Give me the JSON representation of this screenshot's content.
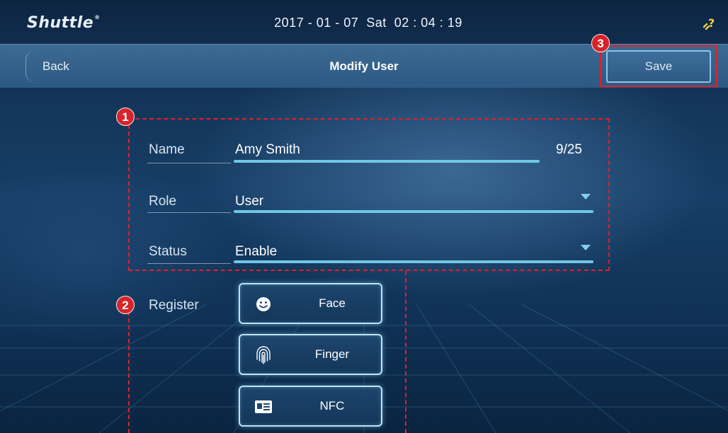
{
  "topbar": {
    "logo": "Shuttle",
    "logo_mark": "®",
    "datetime": "2017 - 01 - 07  Sat  02 : 04 : 19",
    "link_icon": "?"
  },
  "header": {
    "back_label": "Back",
    "title": "Modify User",
    "save_label": "Save"
  },
  "callouts": {
    "fields_group": "1",
    "register_group": "2",
    "save": "3"
  },
  "form": {
    "name": {
      "label": "Name",
      "value": "Amy Smith",
      "counter": "9/25"
    },
    "role": {
      "label": "Role",
      "value": "User"
    },
    "status": {
      "label": "Status",
      "value": "Enable"
    },
    "register": {
      "label": "Register",
      "buttons": [
        {
          "label": "Face",
          "icon": "face-icon"
        },
        {
          "label": "Finger",
          "icon": "fingerprint-icon"
        },
        {
          "label": "NFC",
          "icon": "nfc-card-icon"
        }
      ]
    }
  },
  "colors": {
    "accent": "#6ec8e6",
    "callout_red": "#e0202a",
    "link_icon": "#f3d23a"
  }
}
